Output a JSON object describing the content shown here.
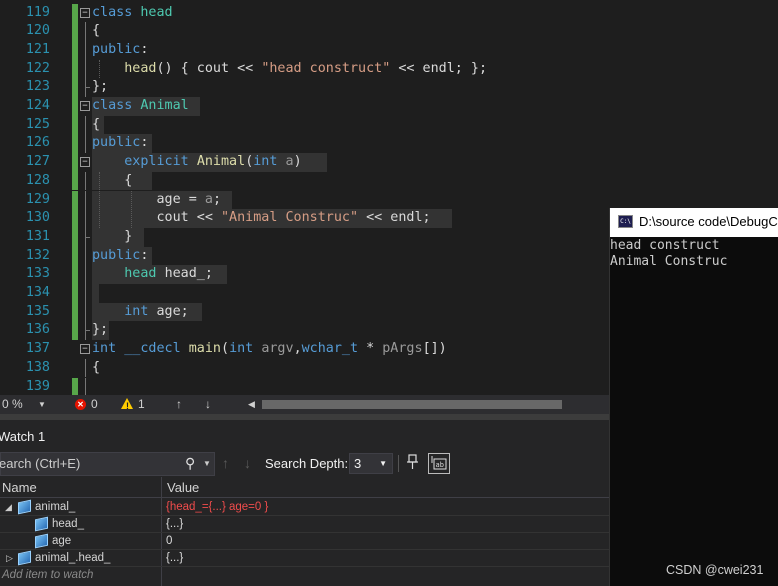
{
  "editor": {
    "lines": [
      {
        "num": "119",
        "tokens": [
          {
            "c": "kw",
            "t": "class "
          },
          {
            "c": "ty",
            "t": "head"
          }
        ]
      },
      {
        "num": "120",
        "tokens": [
          {
            "c": "id",
            "t": "{"
          }
        ]
      },
      {
        "num": "121",
        "tokens": [
          {
            "c": "kw",
            "t": "public"
          },
          {
            "c": "id",
            "t": ":"
          }
        ]
      },
      {
        "num": "122",
        "tokens": [
          {
            "c": "id",
            "t": "    "
          },
          {
            "c": "fn",
            "t": "head"
          },
          {
            "c": "id",
            "t": "() { cout << "
          },
          {
            "c": "st",
            "t": "\"head construct\""
          },
          {
            "c": "id",
            "t": " << endl; };"
          }
        ]
      },
      {
        "num": "123",
        "tokens": [
          {
            "c": "id",
            "t": "};"
          }
        ]
      },
      {
        "num": "124",
        "tokens": [
          {
            "c": "kw",
            "t": "class "
          },
          {
            "c": "ty",
            "t": "Animal"
          }
        ]
      },
      {
        "num": "125",
        "tokens": [
          {
            "c": "id",
            "t": "{"
          }
        ]
      },
      {
        "num": "126",
        "tokens": [
          {
            "c": "kw",
            "t": "public"
          },
          {
            "c": "id",
            "t": ":"
          }
        ]
      },
      {
        "num": "127",
        "tokens": [
          {
            "c": "id",
            "t": "    "
          },
          {
            "c": "kw",
            "t": "explicit "
          },
          {
            "c": "fn",
            "t": "Animal"
          },
          {
            "c": "id",
            "t": "("
          },
          {
            "c": "kw",
            "t": "int "
          },
          {
            "c": "pm",
            "t": "a"
          },
          {
            "c": "id",
            "t": ")"
          }
        ]
      },
      {
        "num": "128",
        "tokens": [
          {
            "c": "id",
            "t": "    {"
          }
        ]
      },
      {
        "num": "129",
        "tokens": [
          {
            "c": "id",
            "t": "        age = "
          },
          {
            "c": "pm",
            "t": "a"
          },
          {
            "c": "id",
            "t": ";"
          }
        ]
      },
      {
        "num": "130",
        "tokens": [
          {
            "c": "id",
            "t": "        cout << "
          },
          {
            "c": "st",
            "t": "\"Animal Construc\""
          },
          {
            "c": "id",
            "t": " << endl;"
          }
        ]
      },
      {
        "num": "131",
        "tokens": [
          {
            "c": "id",
            "t": "    }"
          }
        ]
      },
      {
        "num": "132",
        "tokens": [
          {
            "c": "kw",
            "t": "public"
          },
          {
            "c": "id",
            "t": ":"
          }
        ]
      },
      {
        "num": "133",
        "tokens": [
          {
            "c": "id",
            "t": "    "
          },
          {
            "c": "ty",
            "t": "head "
          },
          {
            "c": "id",
            "t": "head_;"
          }
        ]
      },
      {
        "num": "134",
        "tokens": [
          {
            "c": "id",
            "t": ""
          }
        ]
      },
      {
        "num": "135",
        "tokens": [
          {
            "c": "id",
            "t": "    "
          },
          {
            "c": "kw",
            "t": "int "
          },
          {
            "c": "id",
            "t": "age;"
          }
        ]
      },
      {
        "num": "136",
        "tokens": [
          {
            "c": "id",
            "t": "};"
          }
        ]
      },
      {
        "num": "137",
        "tokens": [
          {
            "c": "kw",
            "t": "int "
          },
          {
            "c": "kw",
            "t": "__cdecl "
          },
          {
            "c": "fn",
            "t": "main"
          },
          {
            "c": "id",
            "t": "("
          },
          {
            "c": "kw",
            "t": "int "
          },
          {
            "c": "pm",
            "t": "argv"
          },
          {
            "c": "id",
            "t": ","
          },
          {
            "c": "kw",
            "t": "wchar_t "
          },
          {
            "c": "id",
            "t": "* "
          },
          {
            "c": "pm",
            "t": "pArgs"
          },
          {
            "c": "id",
            "t": "[])"
          }
        ]
      },
      {
        "num": "138",
        "tokens": [
          {
            "c": "id",
            "t": "{"
          }
        ]
      },
      {
        "num": "139",
        "tokens": [
          {
            "c": "id",
            "t": ""
          }
        ]
      }
    ],
    "fold_glyph": "−"
  },
  "status": {
    "zoom": "0 %",
    "errors": "0",
    "warnings": "1",
    "up_arrow": "↑",
    "down_arrow": "↓"
  },
  "watch": {
    "title": "Watch 1",
    "search_placeholder": "earch (Ctrl+E)",
    "search_depth_label": "Search Depth:",
    "search_depth_value": "3",
    "columns": {
      "name": "Name",
      "value": "Value"
    },
    "rows": [
      {
        "name": "animal_",
        "value": "{head_={...} age=0 }",
        "expanded": true,
        "changed": true,
        "indent": 0
      },
      {
        "name": "head_",
        "value": "{...}",
        "indent": 1
      },
      {
        "name": "age",
        "value": "0",
        "indent": 1
      },
      {
        "name": "animal_.head_",
        "value": "{...}",
        "indent": 0,
        "expandable": true
      }
    ],
    "add_placeholder": "Add item to watch"
  },
  "console": {
    "title": "D:\\source code\\DebugC",
    "icon_text": "C:\\",
    "output": [
      "head construct",
      "Animal Construc"
    ]
  },
  "watermark": "CSDN @cwei231",
  "colors": {
    "keyword": "#569cd6",
    "type": "#4ec9b0",
    "function": "#dcdcaa",
    "string": "#d69d85",
    "line_number": "#2b91af",
    "change_bar": "#57a64a"
  }
}
